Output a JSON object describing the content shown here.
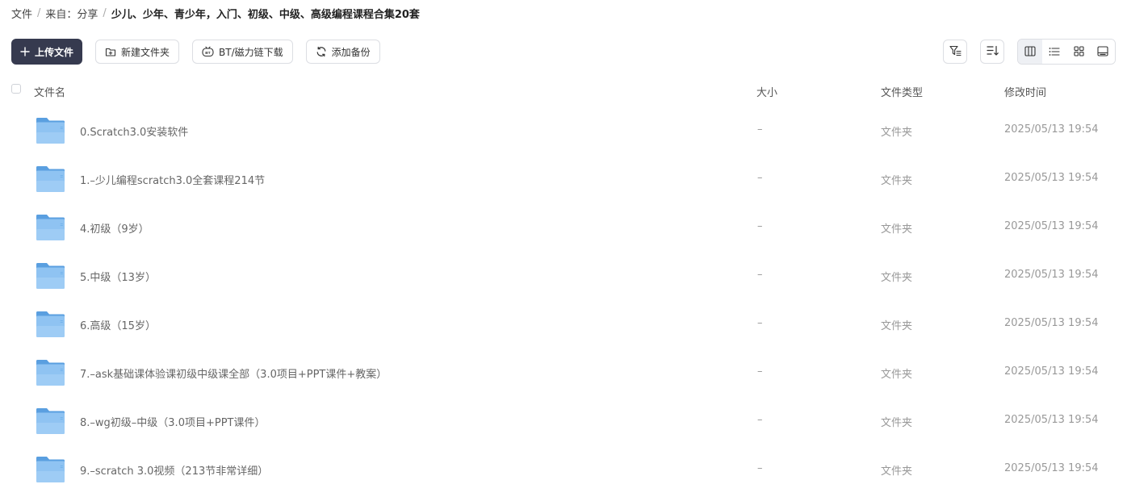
{
  "breadcrumb": {
    "root": "文件",
    "sep": "/",
    "source": "来自：分享",
    "current": "少儿、少年、青少年，入门、初级、中级、高级编程课程合集20套"
  },
  "toolbar": {
    "upload_label": "上传文件",
    "new_folder_label": "新建文件夹",
    "bt_label": "BT/磁力链下载",
    "backup_label": "添加备份"
  },
  "table": {
    "headers": {
      "name": "文件名",
      "size": "大小",
      "type": "文件类型",
      "mtime": "修改时间"
    },
    "rows": [
      {
        "name": "0.Scratch3.0安装软件",
        "size": "–",
        "type": "文件夹",
        "mtime": "2025/05/13 19:54"
      },
      {
        "name": "1.–少儿编程scratch3.0全套课程214节",
        "size": "–",
        "type": "文件夹",
        "mtime": "2025/05/13 19:54"
      },
      {
        "name": "4.初级（9岁）",
        "size": "–",
        "type": "文件夹",
        "mtime": "2025/05/13 19:54"
      },
      {
        "name": "5.中级（13岁）",
        "size": "–",
        "type": "文件夹",
        "mtime": "2025/05/13 19:54"
      },
      {
        "name": "6.高级（15岁）",
        "size": "–",
        "type": "文件夹",
        "mtime": "2025/05/13 19:54"
      },
      {
        "name": "7.–ask基础课体验课初级中级课全部（3.0项目+PPT课件+教案）",
        "size": "–",
        "type": "文件夹",
        "mtime": "2025/05/13 19:54"
      },
      {
        "name": "8.–wg初级–中级（3.0项目+PPT课件）",
        "size": "–",
        "type": "文件夹",
        "mtime": "2025/05/13 19:54"
      },
      {
        "name": "9.–scratch 3.0视频（213节非常详细）",
        "size": "–",
        "type": "文件夹",
        "mtime": "2025/05/13 19:54"
      }
    ]
  },
  "colors": {
    "primary_button": "#363a4f",
    "folder_blue": "#7bb6ec"
  }
}
